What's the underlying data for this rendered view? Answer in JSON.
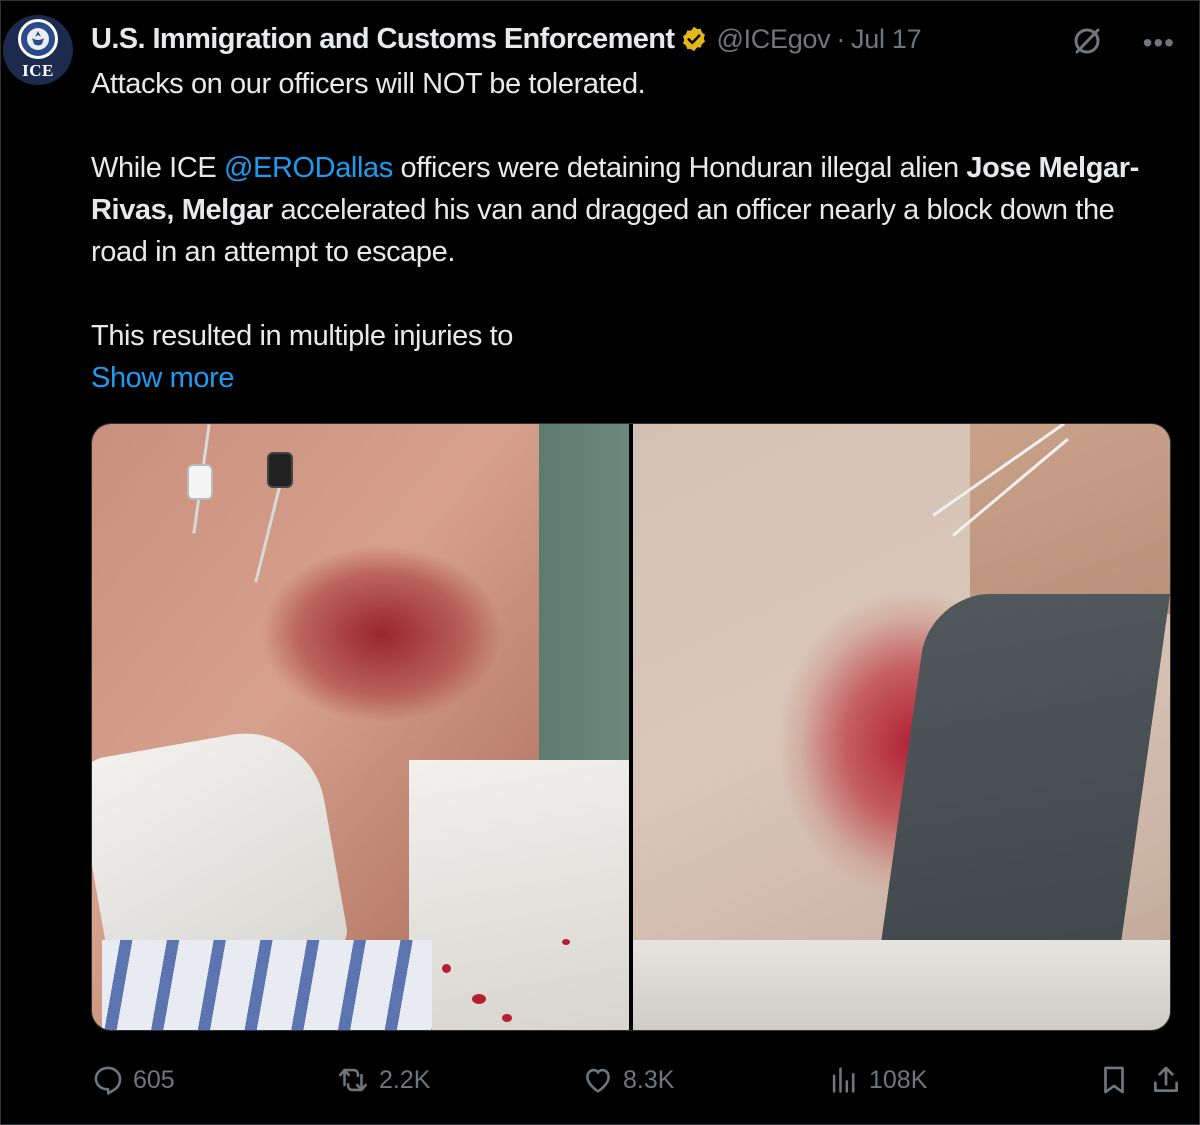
{
  "account": {
    "display_name": "U.S. Immigration and Customs Enforcement",
    "handle": "@ICEgov",
    "separator": "·",
    "date": "Jul 17",
    "avatar_text": "ICE",
    "verified_icon": "gold-verified-badge-icon",
    "verified_color": "#e2b719"
  },
  "tweet": {
    "line1": "Attacks on our officers will NOT be tolerated.",
    "p2_before_mention": "While ICE ",
    "p2_mention": "@ERODallas",
    "p2_after_mention": " officers were detaining Honduran illegal alien ",
    "p2_bold_name": "Jose Melgar-Rivas, Melgar",
    "p2_rest": " accelerated his van and dragged an officer nearly a block down the road in an attempt to escape.",
    "p3": "This resulted in multiple injuries to",
    "show_more": "Show more"
  },
  "media": {
    "count": 2,
    "images": [
      "photo-injured-arm",
      "photo-injured-hip"
    ]
  },
  "actions": {
    "reply_count": "605",
    "retweet_count": "2.2K",
    "like_count": "8.3K",
    "views_count": "108K"
  },
  "colors": {
    "background": "#000000",
    "text": "#e7e9ea",
    "secondary": "#71767b",
    "link": "#1d9bf0",
    "border": "#2f3336"
  }
}
